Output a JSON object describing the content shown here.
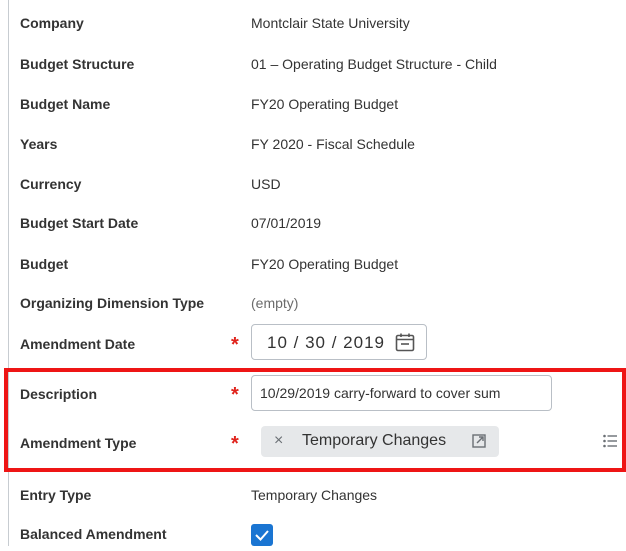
{
  "fields": {
    "company": {
      "label": "Company",
      "value": "Montclair State University"
    },
    "budget_structure": {
      "label": "Budget Structure",
      "value": "01 – Operating Budget Structure - Child"
    },
    "budget_name": {
      "label": "Budget Name",
      "value": "FY20 Operating Budget"
    },
    "years": {
      "label": "Years",
      "value": "FY 2020 - Fiscal Schedule"
    },
    "currency": {
      "label": "Currency",
      "value": "USD"
    },
    "budget_start_date": {
      "label": "Budget Start Date",
      "value": "07/01/2019"
    },
    "budget": {
      "label": "Budget",
      "value": "FY20 Operating Budget"
    },
    "organizing_dimension_type": {
      "label": "Organizing Dimension Type",
      "value": "(empty)"
    },
    "amendment_date": {
      "label": "Amendment Date",
      "required_mark": "*",
      "value": "10 / 30 / 2019"
    },
    "description": {
      "label": "Description",
      "required_mark": "*",
      "value": "10/29/2019 carry-forward to cover sum"
    },
    "amendment_type": {
      "label": "Amendment Type",
      "required_mark": "*",
      "remove_glyph": "×",
      "selected": "Temporary Changes"
    },
    "entry_type": {
      "label": "Entry Type",
      "value": "Temporary Changes"
    },
    "balanced_amendment": {
      "label": "Balanced Amendment",
      "checked": true
    }
  },
  "colors": {
    "required": "#e0231c",
    "highlight": "#ee1515",
    "checkbox": "#1a75d2",
    "pill": "#e6e8ea"
  }
}
